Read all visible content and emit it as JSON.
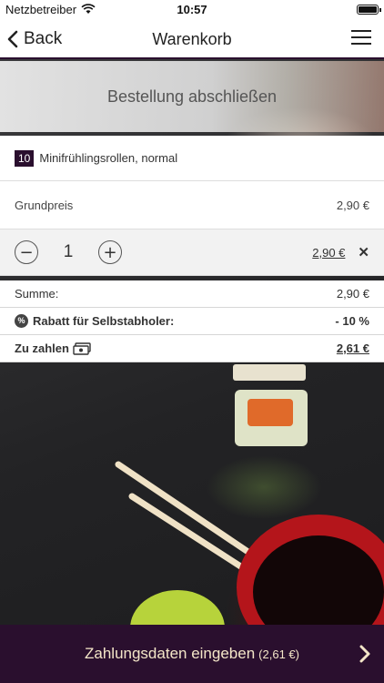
{
  "status": {
    "carrier": "Netzbetreiber",
    "time": "10:57"
  },
  "nav": {
    "back_label": "Back",
    "title": "Warenkorb"
  },
  "banner": {
    "text": "Bestellung abschließen"
  },
  "cart": {
    "item_number": "10",
    "item_name": "Minifrühlingsrollen, normal",
    "base_price_label": "Grundpreis",
    "base_price_value": "2,90 €",
    "quantity": "1",
    "line_total": "2,90 €"
  },
  "totals": {
    "sum_label": "Summe:",
    "sum_value": "2,90 €",
    "discount_label": "Rabatt für Selbstabholer:",
    "discount_value": "- 10 %",
    "pay_label": "Zu zahlen",
    "pay_value": "2,61 €"
  },
  "bottom": {
    "label": "Zahlungsdaten eingeben",
    "amount": "(2,61 €)"
  },
  "colors": {
    "primary": "#2a0f2e",
    "accent_text": "#f4e6c8"
  }
}
